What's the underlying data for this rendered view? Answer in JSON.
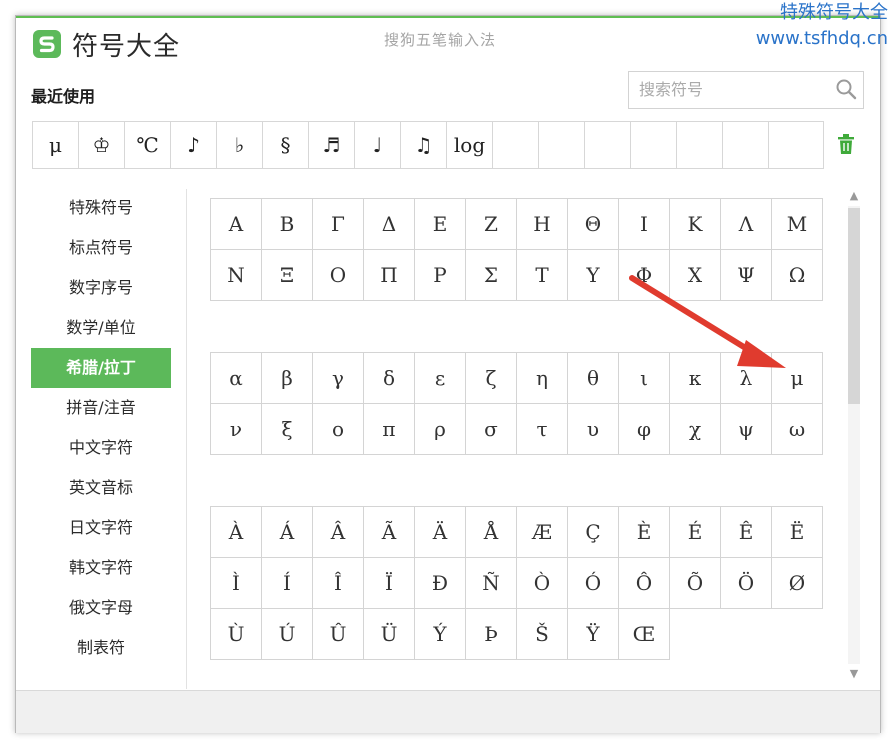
{
  "watermark": {
    "line1": "特殊符号大全",
    "line2": "www.tsfhdq.cn"
  },
  "window": {
    "title": "符号大全",
    "subtitle": "搜狗五笔输入法"
  },
  "recent": {
    "label": "最近使用",
    "items": [
      "μ",
      "♔",
      "℃",
      "♪",
      "♭",
      "§",
      "♬",
      "♩",
      "♫",
      "log",
      "",
      "",
      "",
      "",
      "",
      "",
      ""
    ]
  },
  "search": {
    "placeholder": "搜索符号",
    "value": ""
  },
  "sidebar": {
    "items": [
      {
        "label": "特殊符号"
      },
      {
        "label": "标点符号"
      },
      {
        "label": "数字序号"
      },
      {
        "label": "数学/单位"
      },
      {
        "label": "希腊/拉丁",
        "active": true
      },
      {
        "label": "拼音/注音"
      },
      {
        "label": "中文字符"
      },
      {
        "label": "英文音标"
      },
      {
        "label": "日文字符"
      },
      {
        "label": "韩文字符"
      },
      {
        "label": "俄文字母"
      },
      {
        "label": "制表符"
      }
    ]
  },
  "symbols": {
    "greek_upper": [
      "Α",
      "Β",
      "Γ",
      "Δ",
      "Ε",
      "Ζ",
      "Η",
      "Θ",
      "Ι",
      "Κ",
      "Λ",
      "Μ",
      "Ν",
      "Ξ",
      "Ο",
      "Π",
      "Ρ",
      "Σ",
      "Τ",
      "Υ",
      "Φ",
      "Χ",
      "Ψ",
      "Ω"
    ],
    "greek_lower": [
      "α",
      "β",
      "γ",
      "δ",
      "ε",
      "ζ",
      "η",
      "θ",
      "ι",
      "κ",
      "λ",
      "μ",
      "ν",
      "ξ",
      "ο",
      "π",
      "ρ",
      "σ",
      "τ",
      "υ",
      "φ",
      "χ",
      "ψ",
      "ω"
    ],
    "latin": [
      "À",
      "Á",
      "Â",
      "Ã",
      "Ä",
      "Å",
      "Æ",
      "Ç",
      "È",
      "É",
      "Ê",
      "Ë",
      "Ì",
      "Í",
      "Î",
      "Ï",
      "Ð",
      "Ñ",
      "Ò",
      "Ó",
      "Ô",
      "Õ",
      "Ö",
      "Ø",
      "Ù",
      "Ú",
      "Û",
      "Ü",
      "Ý",
      "Þ",
      "Š",
      "Ÿ",
      "Œ"
    ]
  },
  "icons": {
    "logo": "sogou-s-icon",
    "search": "search-icon",
    "trash": "trash-icon"
  },
  "colors": {
    "accent": "#5cb95a",
    "arrow": "#e03b2e",
    "watermark": "#2a73c9"
  }
}
